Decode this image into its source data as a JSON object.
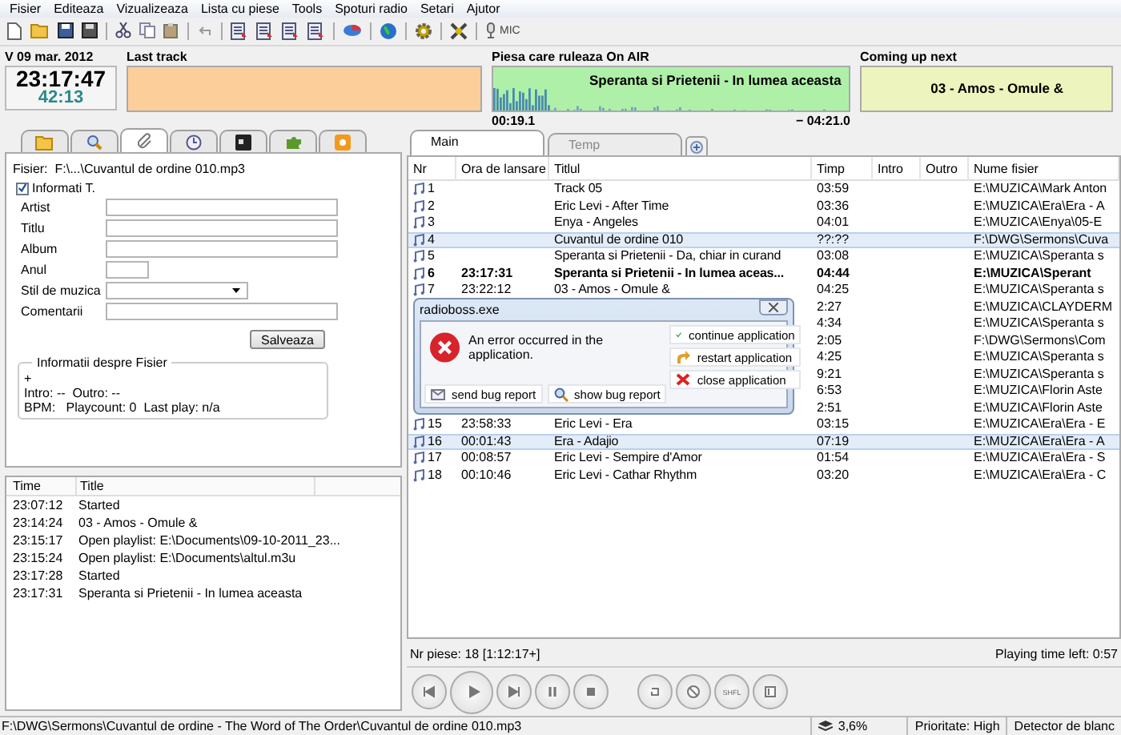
{
  "menu": [
    "Fisier",
    "Editeaza",
    "Vizualizeaza",
    "Lista cu piese",
    "Tools",
    "Spoturi radio",
    "Setari",
    "Ajutor"
  ],
  "toolbar": {
    "mic_label": "MIC"
  },
  "clock": {
    "date": "V 09 mar. 2012",
    "time": "23:17:47",
    "remaining": "42:13"
  },
  "last_track": {
    "title": "Last track"
  },
  "on_air": {
    "title": "Piesa care ruleaza On AIR",
    "track": "Speranta si Prietenii - In lumea aceasta",
    "elapsed": "00:19.1",
    "remaining": "− 04:21.0"
  },
  "coming_next": {
    "title": "Coming up next",
    "track": "03 - Amos - Omule &"
  },
  "side_tabs": [
    {
      "kind": "folder",
      "selected": false
    },
    {
      "kind": "search",
      "selected": false
    },
    {
      "kind": "paperclip",
      "selected": true
    },
    {
      "kind": "clock",
      "selected": false
    },
    {
      "kind": "terminal",
      "selected": false
    },
    {
      "kind": "puzzle",
      "selected": false
    },
    {
      "kind": "gear",
      "selected": false
    }
  ],
  "tag_editor": {
    "file_label": "Fisier:",
    "file": "F:\\...\\Cuvantul de ordine 010.mp3",
    "checkbox": {
      "label": "Informati T.",
      "checked": true
    },
    "fields": [
      {
        "label": "Artist",
        "kind": "text"
      },
      {
        "label": "Titlu",
        "kind": "text"
      },
      {
        "label": "Album",
        "kind": "text"
      },
      {
        "label": "Anul",
        "kind": "short"
      },
      {
        "label": "Stil de muzica",
        "kind": "dropdown"
      },
      {
        "label": "Comentarii",
        "kind": "text"
      }
    ],
    "save_button": "Salveaza",
    "info": {
      "title": "Informatii despre Fisier",
      "lines": [
        "+",
        "Intro: --  Outro: --",
        "BPM:   Playcount: 0  Last play: n/a"
      ]
    }
  },
  "log": {
    "columns": [
      "Time",
      "Title"
    ],
    "rows": [
      {
        "time": "23:07:12",
        "title": "Started"
      },
      {
        "time": "23:14:24",
        "title": "03 - Amos - Omule &"
      },
      {
        "time": "23:15:17",
        "title": "Open playlist: E:\\Documents\\09-10-2011_23..."
      },
      {
        "time": "23:15:24",
        "title": "Open playlist: E:\\Documents\\altul.m3u"
      },
      {
        "time": "23:17:28",
        "title": "Started"
      },
      {
        "time": "23:17:31",
        "title": "Speranta si Prietenii - In lumea aceasta"
      }
    ]
  },
  "playlist": {
    "tabs": [
      {
        "label": "Main",
        "selected": true
      },
      {
        "label": "Temp",
        "selected": false
      }
    ],
    "columns": [
      "Nr",
      "Ora de lansare",
      "Titlul",
      "Timp",
      "Intro",
      "Outro",
      "Nume fisier"
    ],
    "rows": [
      {
        "nr": "1",
        "title": "Track 05",
        "time": "03:59",
        "file": "E:\\MUZICA\\Mark Anton",
        "selected": false,
        "playing": false
      },
      {
        "nr": "2",
        "title": "Eric Levi - After Time",
        "time": "03:36",
        "file": "E:\\MUZICA\\Era\\Era - A",
        "selected": false,
        "playing": false
      },
      {
        "nr": "3",
        "title": "Enya - Angeles",
        "time": "04:01",
        "file": "E:\\MUZICA\\Enya\\05-E",
        "selected": false,
        "playing": false
      },
      {
        "nr": "4",
        "title": "Cuvantul de ordine 010",
        "time": "??:??",
        "file": "F:\\DWG\\Sermons\\Cuva",
        "selected": true,
        "playing": false
      },
      {
        "nr": "5",
        "title": "Speranta si Prietenii - Da, chiar in curand",
        "time": "03:08",
        "file": "E:\\MUZICA\\Speranta s",
        "selected": false,
        "playing": false
      },
      {
        "nr": "6",
        "start": "23:17:31",
        "title": "Speranta si Prietenii - In lumea aceas...",
        "time": "04:44",
        "file": "E:\\MUZICA\\Sperant",
        "selected": false,
        "playing": true
      },
      {
        "nr": "7",
        "start": "23:22:12",
        "title": "03 - Amos - Omule &",
        "time": "04:25",
        "file": "E:\\MUZICA\\Speranta s",
        "selected": false,
        "playing": false
      },
      {
        "time": "2:27",
        "file": "E:\\MUZICA\\CLAYDERM",
        "selected": false,
        "playing": false
      },
      {
        "time": "4:34",
        "file": "E:\\MUZICA\\Speranta s",
        "selected": false,
        "playing": false
      },
      {
        "time": "2:05",
        "file": "F:\\DWG\\Sermons\\Com",
        "selected": false,
        "playing": false
      },
      {
        "time": "4:25",
        "file": "E:\\MUZICA\\Speranta s",
        "selected": false,
        "playing": false
      },
      {
        "time": "9:21",
        "file": "E:\\MUZICA\\Speranta s",
        "selected": false,
        "playing": false
      },
      {
        "time": "6:53",
        "file": "E:\\MUZICA\\Florin Aste",
        "selected": false,
        "playing": false
      },
      {
        "time": "2:51",
        "file": "E:\\MUZICA\\Florin Aste",
        "selected": false,
        "playing": false
      },
      {
        "nr": "15",
        "start": "23:58:33",
        "title": "Eric Levi - Era",
        "time": "03:15",
        "file": "E:\\MUZICA\\Era\\Era - E",
        "selected": false,
        "playing": false
      },
      {
        "nr": "16",
        "start": "00:01:43",
        "title": "Era - Adajio",
        "time": "07:19",
        "file": "E:\\MUZICA\\Era\\Era - A",
        "selected": true,
        "playing": false
      },
      {
        "nr": "17",
        "start": "00:08:57",
        "title": "Eric Levi - Sempire d'Amor",
        "time": "01:54",
        "file": "E:\\MUZICA\\Era\\Era - S",
        "selected": false,
        "playing": false
      },
      {
        "nr": "18",
        "start": "00:10:46",
        "title": "Eric Levi - Cathar Rhythm",
        "time": "03:20",
        "file": "E:\\MUZICA\\Era\\Era - C",
        "selected": false,
        "playing": false
      }
    ],
    "summary": "Nr piese: 18 [1:12:17+]",
    "time_left": "Playing time left: 0:57"
  },
  "transport": {
    "shuffle_label": "SHFL"
  },
  "dialog": {
    "title": "radioboss.exe",
    "message": "An error occurred in the application.",
    "actions": [
      "continue application",
      "restart application",
      "close application"
    ],
    "reports": [
      "send bug report",
      "show bug report"
    ]
  },
  "status_bar": {
    "path": "F:\\DWG\\Sermons\\Cuvantul de ordine - The Word of The Order\\Cuvantul de ordine 010.mp3",
    "cpu": "3,6%",
    "priority": "Prioritate: High",
    "blank_detector": "Detector de blanc"
  }
}
